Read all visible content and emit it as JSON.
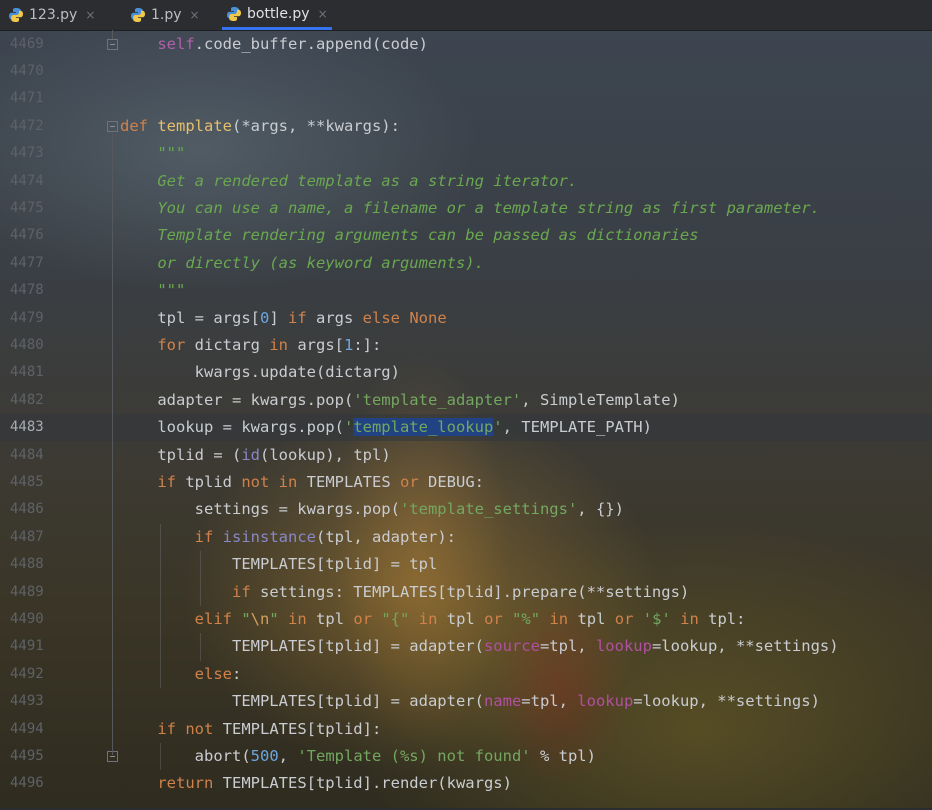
{
  "tabs": [
    {
      "name": "123.py"
    },
    {
      "name": "1.py"
    },
    {
      "name": "bottle.py",
      "active": true
    }
  ],
  "tab_close_glyph": "×",
  "current_line": "4483",
  "lines": [
    {
      "n": "4469",
      "html": "    <span class=\"self\">self</span>.code_buffer.append(code)"
    },
    {
      "n": "4470",
      "html": ""
    },
    {
      "n": "4471",
      "html": ""
    },
    {
      "n": "4472",
      "html": "<span class=\"kw\">def</span> <span class=\"fn\">template</span>(*args, **kwargs):"
    },
    {
      "n": "4473",
      "html": "    <span class=\"doc\">\"\"\"</span>"
    },
    {
      "n": "4474",
      "html": "    <span class=\"doc\">Get a rendered template as a string iterator.</span>"
    },
    {
      "n": "4475",
      "html": "    <span class=\"doc\">You can use a name, a filename or a template string as first parameter.</span>"
    },
    {
      "n": "4476",
      "html": "    <span class=\"doc\">Template rendering arguments can be passed as dictionaries</span>"
    },
    {
      "n": "4477",
      "html": "    <span class=\"doc\">or directly (as keyword arguments).</span>"
    },
    {
      "n": "4478",
      "html": "    <span class=\"doc\">\"\"\"</span>"
    },
    {
      "n": "4479",
      "html": "    tpl = args[<span class=\"num\">0</span>] <span class=\"kw\">if</span> args <span class=\"kw\">else</span> <span class=\"kw\">None</span>"
    },
    {
      "n": "4480",
      "html": "    <span class=\"kw\">for</span> dictarg <span class=\"kw\">in</span> args[<span class=\"num\">1</span>:]:"
    },
    {
      "n": "4481",
      "html": "        kwargs.update(dictarg)"
    },
    {
      "n": "4482",
      "html": "    adapter = kwargs.pop(<span class=\"str\">'template_adapter'</span>, SimpleTemplate)"
    },
    {
      "n": "4483",
      "html": "    lookup = kwargs.pop(<span class=\"str\">'<span class=\"sel\">template_lookup</span>'</span>, TEMPLATE_PATH)"
    },
    {
      "n": "4484",
      "html": "    tplid = (<span class=\"builtin\">id</span>(lookup), tpl)"
    },
    {
      "n": "4485",
      "html": "    <span class=\"kw\">if</span> tplid <span class=\"kw\">not in</span> TEMPLATES <span class=\"kw\">or</span> DEBUG:"
    },
    {
      "n": "4486",
      "html": "        settings = kwargs.pop(<span class=\"str\">'template_settings'</span>, {})"
    },
    {
      "n": "4487",
      "html": "        <span class=\"kw\">if</span> <span class=\"builtin\">isinstance</span>(tpl, adapter):"
    },
    {
      "n": "4488",
      "html": "            TEMPLATES[tplid] = tpl"
    },
    {
      "n": "4489",
      "html": "            <span class=\"kw\">if</span> settings: TEMPLATES[tplid].prepare(**settings)"
    },
    {
      "n": "4490",
      "html": "        <span class=\"kw\">elif</span> <span class=\"str\">\"<span class=\"esc\">\\n</span>\"</span> <span class=\"kw\">in</span> tpl <span class=\"kw\">or</span> <span class=\"str\">\"{\"</span> <span class=\"kw\">in</span> tpl <span class=\"kw\">or</span> <span class=\"str\">\"%\"</span> <span class=\"kw\">in</span> tpl <span class=\"kw\">or</span> <span class=\"str\">'$'</span> <span class=\"kw\">in</span> tpl:"
    },
    {
      "n": "4491",
      "html": "            TEMPLATES[tplid] = adapter(<span class=\"param\">source</span>=tpl, <span class=\"param\">lookup</span>=lookup, **settings)"
    },
    {
      "n": "4492",
      "html": "        <span class=\"kw\">else</span>:"
    },
    {
      "n": "4493",
      "html": "            TEMPLATES[tplid] = adapter(<span class=\"param\">name</span>=tpl, <span class=\"param\">lookup</span>=lookup, **settings)"
    },
    {
      "n": "4494",
      "html": "    <span class=\"kw\">if not</span> TEMPLATES[tplid]:"
    },
    {
      "n": "4495",
      "html": "        abort(<span class=\"num\">500</span>, <span class=\"str\">'Template (%s) not found'</span> % tpl)"
    },
    {
      "n": "4496",
      "html": "    <span class=\"kw\">return</span> TEMPLATES[tplid].render(kwargs)"
    }
  ],
  "colors": {
    "keyword": "#d0824a",
    "function": "#e8bf6a",
    "string": "#73a760",
    "docstring": "#6aa84f",
    "number": "#6aa7e0",
    "active_tab_underline": "#3574f0",
    "selection": "#214283"
  },
  "icons": {
    "tab_file": "python-file-icon"
  }
}
